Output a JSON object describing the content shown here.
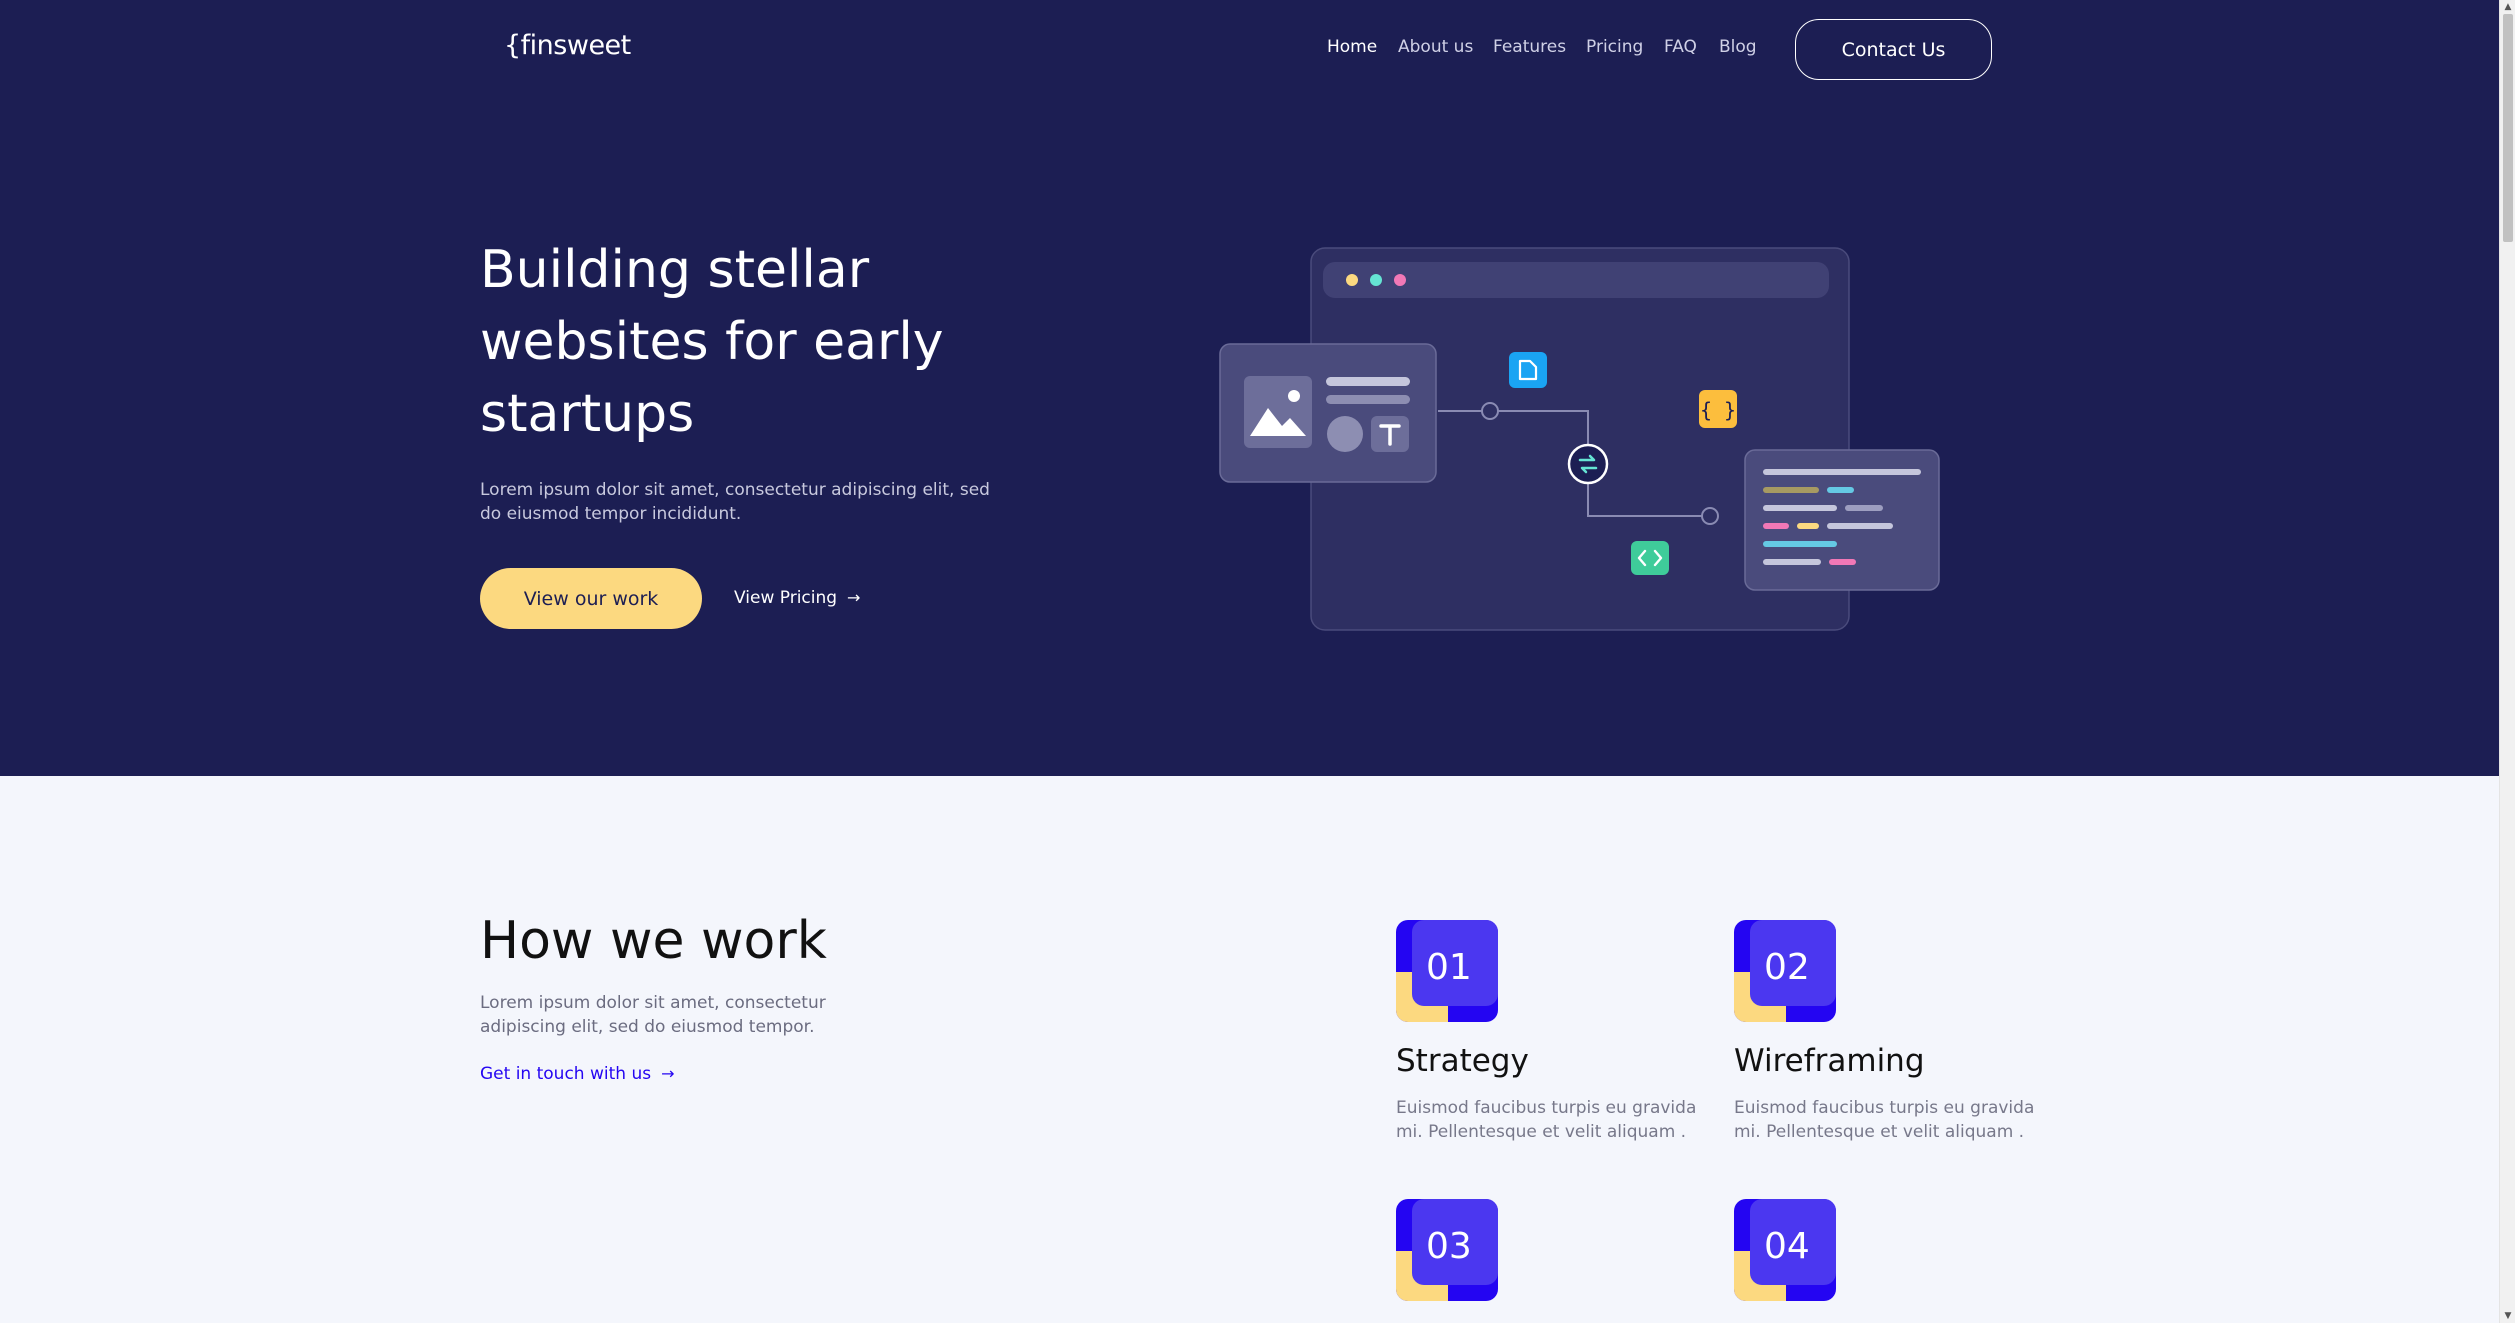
{
  "header": {
    "logo": "{finsweet",
    "nav": [
      "Home",
      "About us",
      "Features",
      "Pricing",
      "FAQ",
      "Blog"
    ],
    "active_nav": "Home",
    "contact_label": "Contact Us"
  },
  "hero": {
    "title": "Building stellar websites for early startups",
    "subtitle": "Lorem ipsum dolor sit amet, consectetur adipiscing elit, sed do eiusmod tempor incididunt.",
    "primary_button": "View our work",
    "secondary_link": "View Pricing",
    "arrow": "→"
  },
  "how": {
    "title": "How we work",
    "subtitle": "Lorem ipsum dolor sit amet, consectetur adipiscing elit, sed do eiusmod tempor.",
    "link": "Get in touch with us",
    "arrow": "→",
    "steps": [
      {
        "num": "01",
        "title": "Strategy",
        "desc": "Euismod faucibus turpis eu gravida mi. Pellentesque et velit aliquam ."
      },
      {
        "num": "02",
        "title": "Wireframing",
        "desc": "Euismod faucibus turpis eu gravida mi. Pellentesque et velit aliquam ."
      },
      {
        "num": "03",
        "title": "",
        "desc": ""
      },
      {
        "num": "04",
        "title": "",
        "desc": ""
      }
    ]
  },
  "colors": {
    "navy": "#1c1e53",
    "yellow": "#fcd980",
    "blue": "#2405f2",
    "background": "#f4f6fc"
  },
  "icons": [
    "image-icon",
    "text-icon",
    "file-icon",
    "curly-braces-icon",
    "sync-icon",
    "code-icon",
    "arrow-right-icon"
  ]
}
